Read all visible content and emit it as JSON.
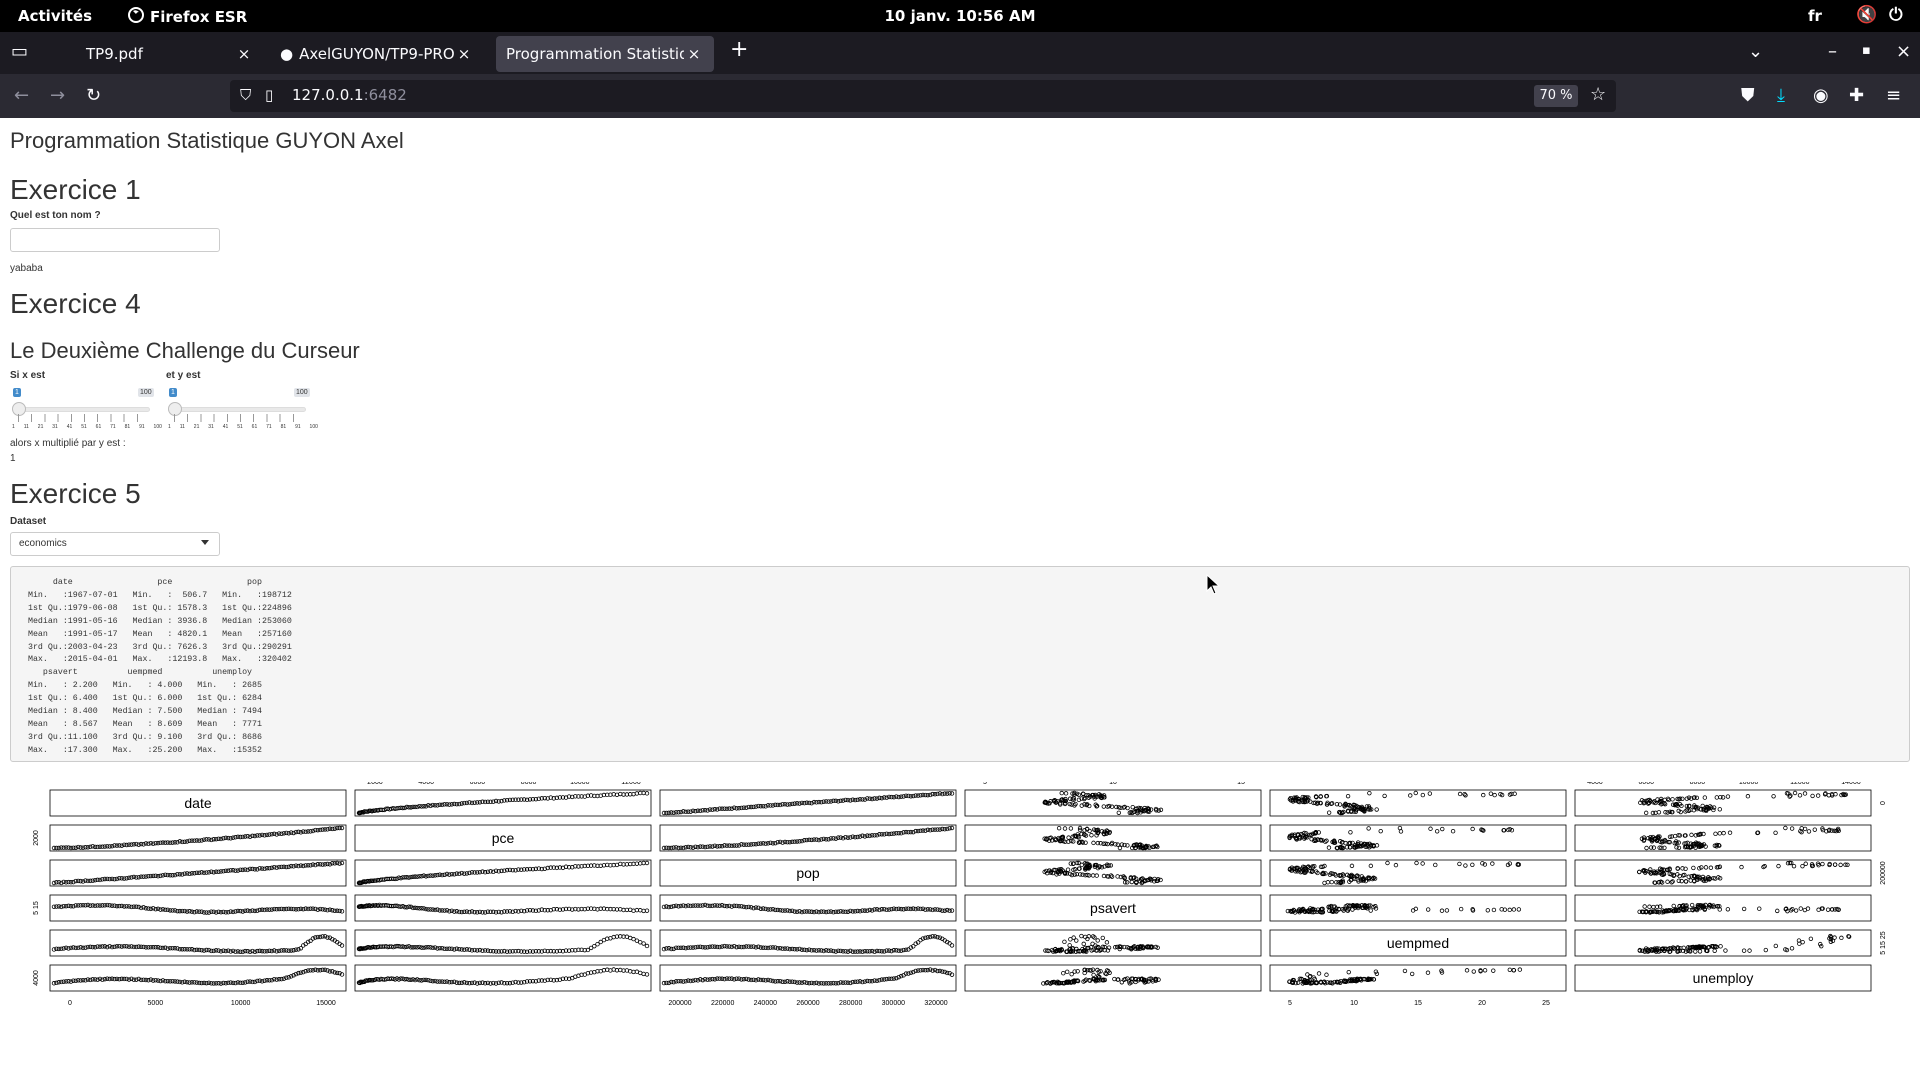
{
  "topbar": {
    "activities": "Activités",
    "app": "Firefox ESR",
    "clock": "10 janv.  10:56 AM",
    "lang": "fr"
  },
  "tabs": [
    {
      "title": "TP9.pdf",
      "active": false
    },
    {
      "title": "AxelGUYON/TP9-PROG",
      "active": false
    },
    {
      "title": "Programmation Statistique",
      "active": true
    }
  ],
  "urlbar": {
    "host": "127.0.0.1",
    "port": ":6482",
    "zoom": "70 %"
  },
  "page": {
    "title": "Programmation Statistique GUYON Axel",
    "ex1": "Exercice 1",
    "name_label": "Quel est ton nom ?",
    "name_value": "",
    "name_output": "yababa",
    "ex4": "Exercice 4",
    "challenge": "Le Deuxième Challenge du Curseur",
    "slider_x_label": "Si x est",
    "slider_y_label": "et y est",
    "slider_x": {
      "value": "1",
      "max": "100"
    },
    "slider_y": {
      "value": "1",
      "max": "100"
    },
    "slider_grid": [
      "1",
      "11",
      "21",
      "31",
      "41",
      "51",
      "61",
      "71",
      "81",
      "91",
      "100"
    ],
    "product_label": "alors x multiplié par y est :",
    "product_value": "1",
    "ex5": "Exercice 5",
    "dataset_label": "Dataset",
    "dataset_value": "economics",
    "summary": "      date                 pce               pop        \n Min.   :1967-07-01   Min.   :  506.7   Min.   :198712  \n 1st Qu.:1979-06-08   1st Qu.: 1578.3   1st Qu.:224896  \n Median :1991-05-16   Median : 3936.8   Median :253060  \n Mean   :1991-05-17   Mean   : 4820.1   Mean   :257160  \n 3rd Qu.:2003-04-23   3rd Qu.: 7626.3   3rd Qu.:290291  \n Max.   :2015-04-01   Max.   :12193.8   Max.   :320402  \n    psavert          uempmed          unemploy    \n Min.   : 2.200   Min.   : 4.000   Min.   : 2685  \n 1st Qu.: 6.400   1st Qu.: 6.000   1st Qu.: 6284  \n Median : 8.400   Median : 7.500   Median : 7494  \n Mean   : 8.567   Mean   : 8.609   Mean   : 7771  \n 3rd Qu.:11.100   3rd Qu.: 9.100   3rd Qu.: 8686  \n Max.   :17.300   Max.   :25.200   Max.   :15352  "
  },
  "chart_data": {
    "type": "scatter",
    "variables": [
      "date",
      "pce",
      "pop",
      "psavert",
      "uempmed",
      "unemploy"
    ],
    "top_axis": {
      "pce": [
        "2000",
        "4000",
        "6000",
        "8000",
        "10000",
        "12000"
      ],
      "psavert": [
        "5",
        "10",
        "15"
      ],
      "unemploy": [
        "4000",
        "6000",
        "8000",
        "10000",
        "12000",
        "14000"
      ]
    },
    "bottom_axis": {
      "date": [
        "0",
        "5000",
        "10000",
        "15000"
      ],
      "pop": [
        "200000",
        "220000",
        "240000",
        "260000",
        "280000",
        "300000",
        "320000"
      ],
      "uempmed": [
        "5",
        "10",
        "15",
        "20",
        "25"
      ]
    },
    "left_axis": {
      "pce": "2000",
      "psavert": "5 15",
      "unemploy": "4000"
    },
    "right_axis": {
      "date": "0",
      "pop": "200000",
      "uempmed": "5 15 25"
    },
    "grid": false,
    "legend": "none"
  }
}
